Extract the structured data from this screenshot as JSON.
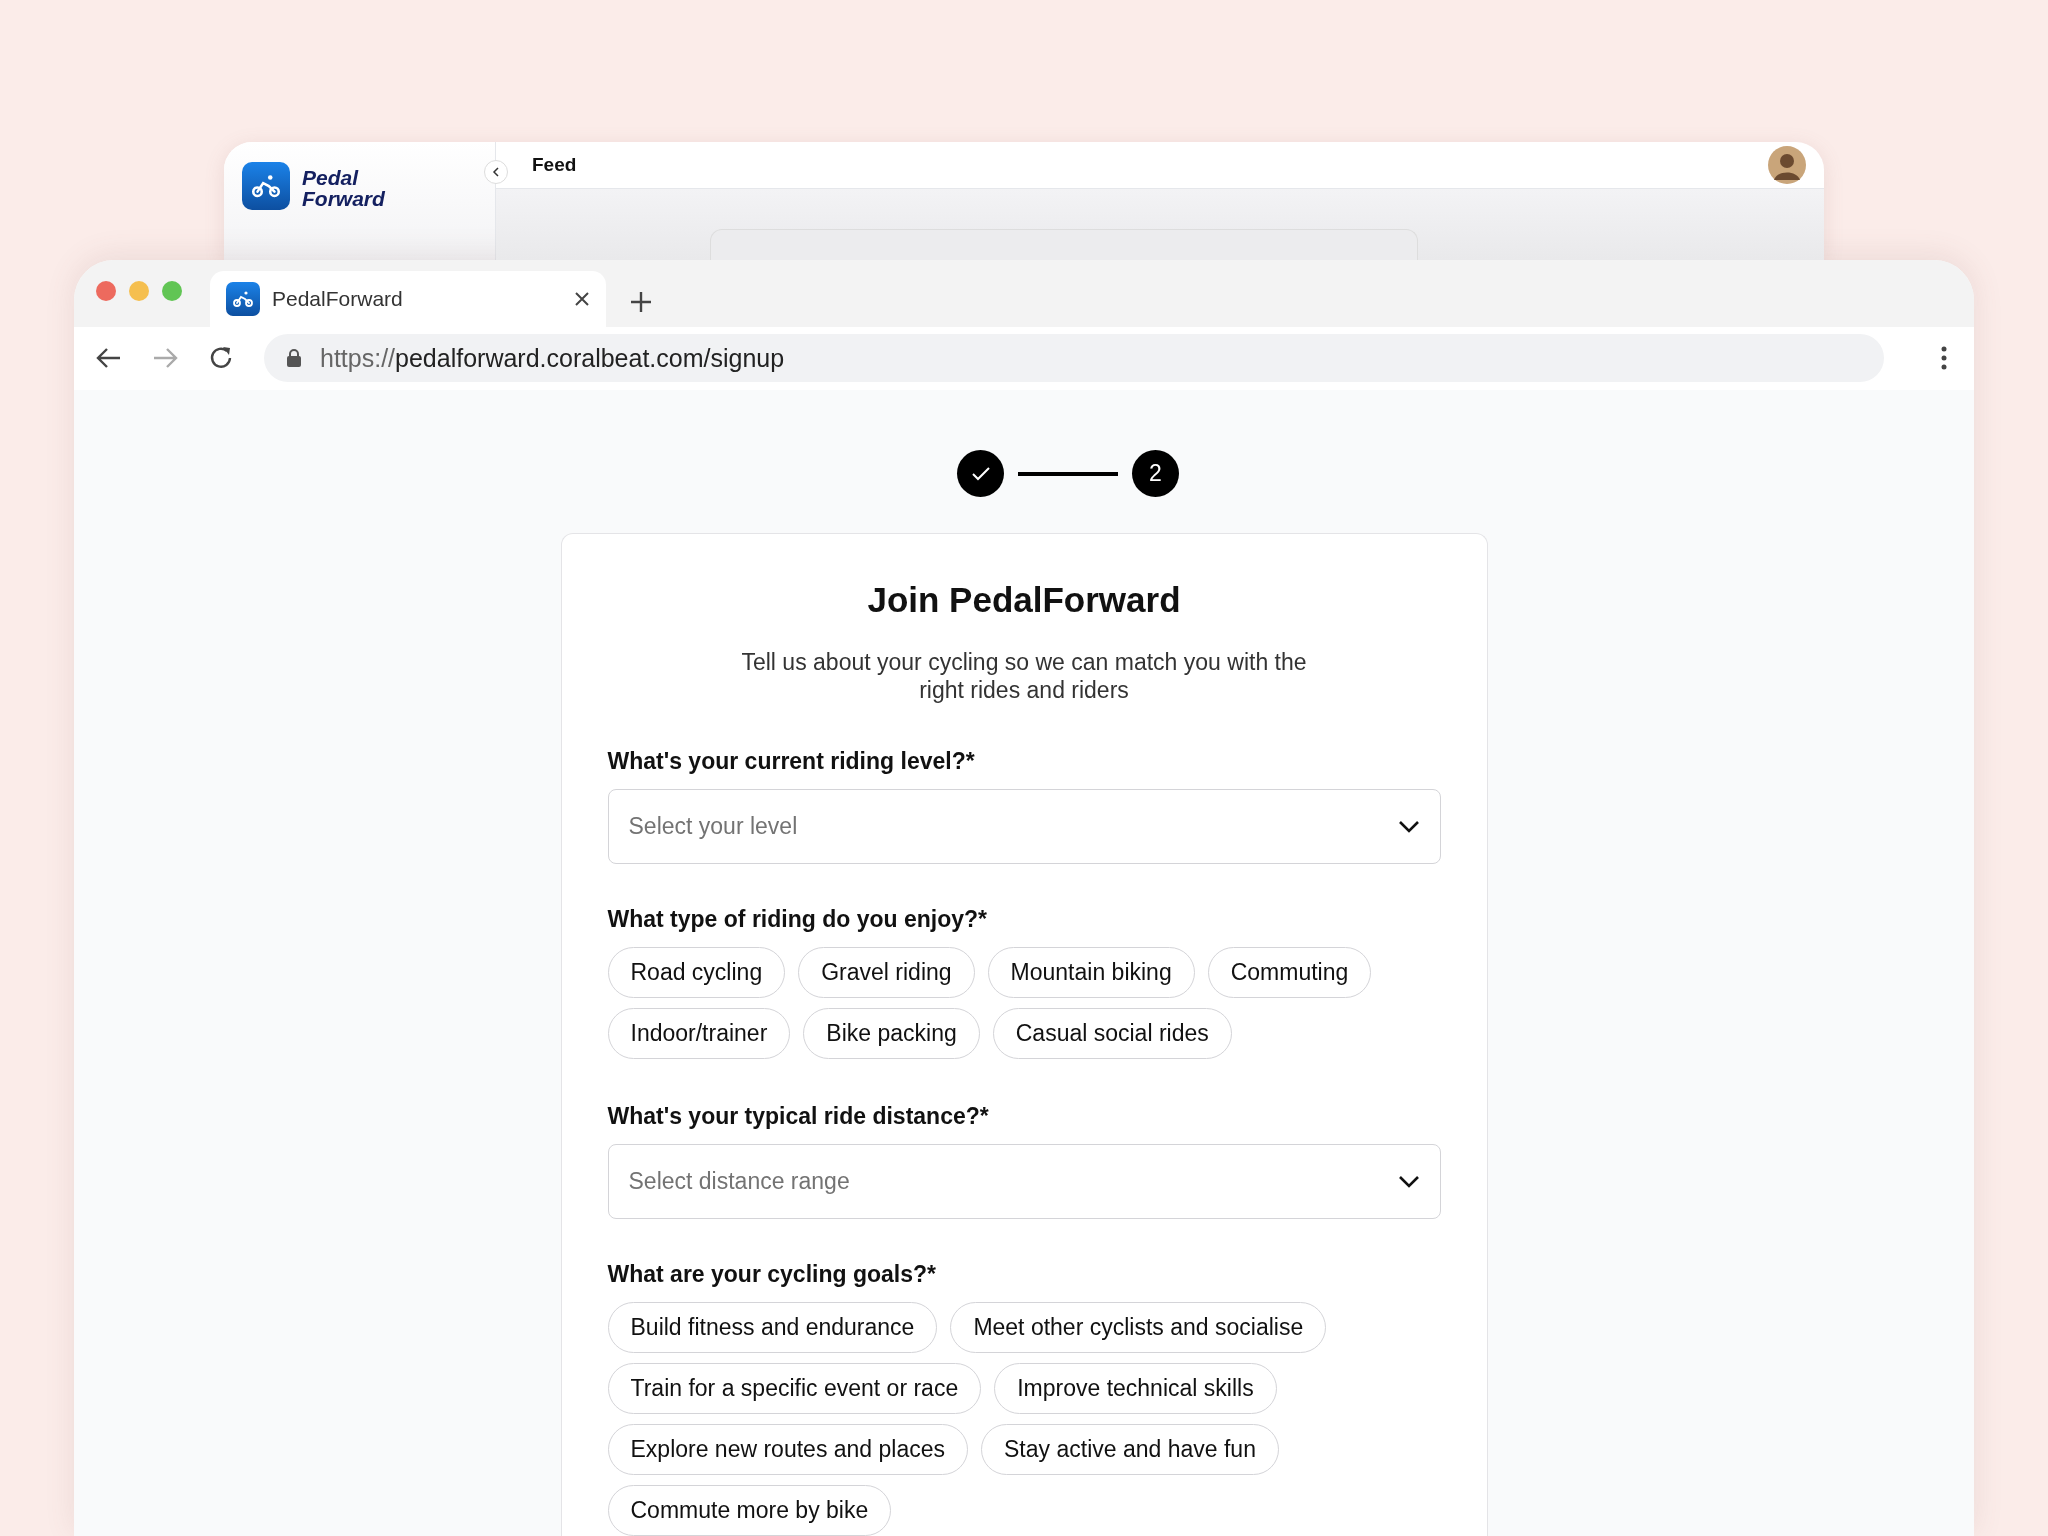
{
  "back_window": {
    "logo_text": "Pedal Forward",
    "page_title": "Feed"
  },
  "browser": {
    "tab": {
      "title": "PedalForward"
    },
    "url": {
      "scheme": "https://",
      "address": "pedalforward.coralbeat.com/signup"
    }
  },
  "stepper": [
    {
      "completed": true
    },
    {
      "completed": false,
      "label": "2"
    }
  ],
  "form": {
    "title": "Join PedalForward",
    "subtitle": "Tell us about your cycling so we can match you with the right rides and riders",
    "fields": [
      {
        "kind": "select",
        "label": "What's your current riding level?*",
        "placeholder": "Select your level"
      },
      {
        "kind": "chips",
        "label": "What type of riding do you enjoy?*",
        "options": [
          {
            "label": "Road cycling",
            "selected": false
          },
          {
            "label": "Gravel riding",
            "selected": false
          },
          {
            "label": "Mountain biking",
            "selected": false
          },
          {
            "label": "Commuting",
            "selected": false
          },
          {
            "label": "Indoor/trainer",
            "selected": false
          },
          {
            "label": "Bike packing",
            "selected": false
          },
          {
            "label": "Casual social rides",
            "selected": false
          }
        ]
      },
      {
        "kind": "select",
        "label": "What's your typical ride distance?*",
        "placeholder": "Select distance range"
      },
      {
        "kind": "chips",
        "label": "What are your cycling goals?*",
        "options": [
          {
            "label": "Build fitness and endurance",
            "selected": false
          },
          {
            "label": "Meet other cyclists and socialise",
            "selected": false
          },
          {
            "label": "Train for a specific event or race",
            "selected": false
          },
          {
            "label": "Improve technical skills",
            "selected": false
          },
          {
            "label": "Explore new routes and places",
            "selected": false
          },
          {
            "label": "Stay active and have fun",
            "selected": false
          },
          {
            "label": "Commute more by bike",
            "selected": false
          }
        ]
      }
    ]
  }
}
